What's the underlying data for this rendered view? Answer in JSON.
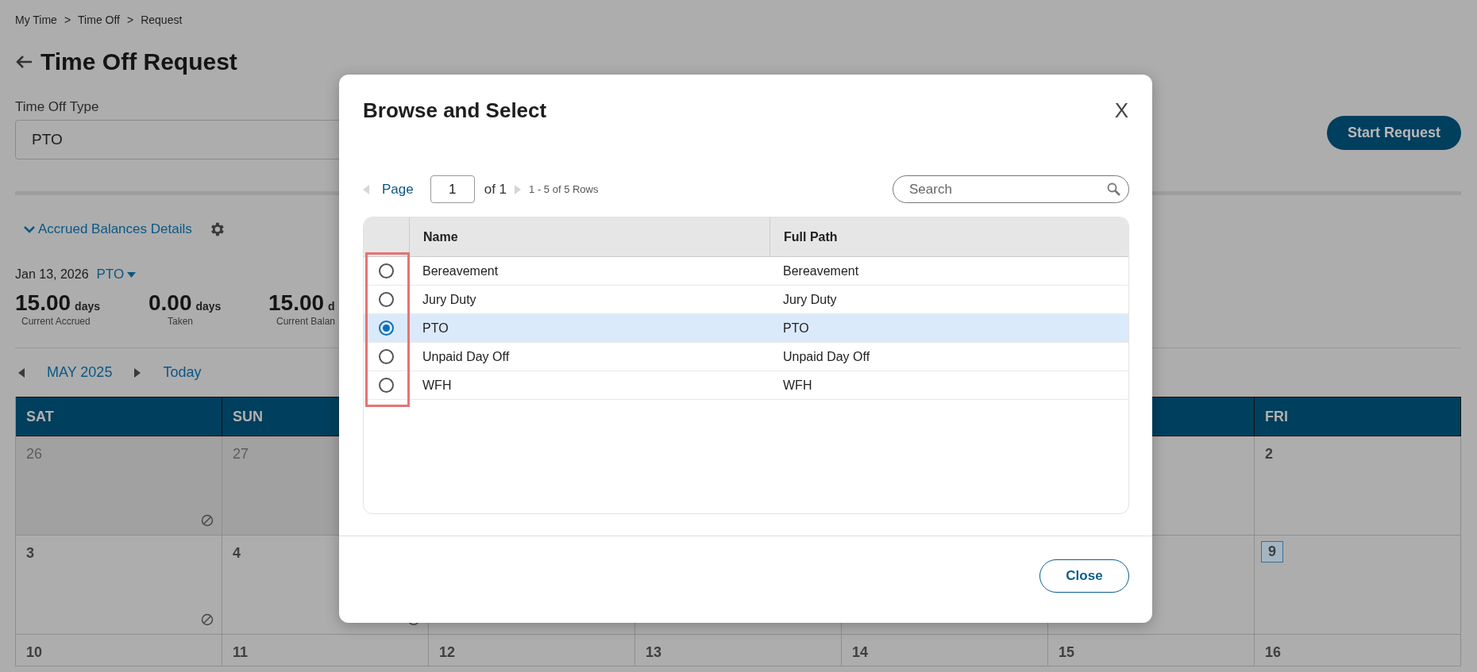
{
  "breadcrumb": {
    "separator": ">",
    "items": [
      "My Time",
      "Time Off",
      "Request"
    ]
  },
  "page_title": "Time Off Request",
  "time_off_type": {
    "label": "Time Off Type",
    "value": "PTO"
  },
  "start_request_button": "Start Request",
  "accrued_toggle": {
    "label": "Accrued Balances Details",
    "expanded": true
  },
  "balance_date": "Jan 13, 2026",
  "balance_type": "PTO",
  "balances": [
    {
      "value": "15.00",
      "unit": "days",
      "label": "Current Accrued"
    },
    {
      "value": "0.00",
      "unit": "days",
      "label": "Taken"
    },
    {
      "value": "15.00",
      "unit": "d",
      "label": "Current Balan"
    }
  ],
  "month_nav": {
    "month": "MAY 2025",
    "today": "Today"
  },
  "calendar": {
    "columns": [
      {
        "label": "SAT"
      },
      {
        "label": "SUN"
      },
      {},
      {},
      {},
      {},
      {
        "label": "FRI"
      }
    ],
    "rows": [
      [
        {
          "day": "26",
          "muted": true,
          "blocked": true
        },
        {
          "day": "27",
          "muted": true,
          "blocked": false
        },
        {},
        {},
        {},
        {},
        {
          "day": "2",
          "muted": false,
          "blocked": false,
          "today": false
        }
      ],
      [
        {
          "day": "3",
          "muted": false,
          "blocked": true
        },
        {
          "day": "4",
          "muted": false,
          "blocked": true
        },
        {},
        {},
        {},
        {},
        {
          "day": "9",
          "muted": false,
          "blocked": false,
          "today": true
        }
      ],
      [
        {
          "day": "10"
        },
        {
          "day": "11"
        },
        {
          "day": "12"
        },
        {
          "day": "13"
        },
        {
          "day": "14"
        },
        {
          "day": "15"
        },
        {
          "day": "16"
        }
      ]
    ]
  },
  "dialog": {
    "title": "Browse and Select",
    "close_icon": "X",
    "pager": {
      "label": "Page",
      "page": "1",
      "of": "of 1",
      "rows_info": "1 - 5 of 5 Rows"
    },
    "search": {
      "placeholder": "Search"
    },
    "table": {
      "columns": [
        "Name",
        "Full Path"
      ],
      "rows": [
        {
          "name": "Bereavement",
          "full_path": "Bereavement",
          "selected": false
        },
        {
          "name": "Jury Duty",
          "full_path": "Jury Duty",
          "selected": false
        },
        {
          "name": "PTO",
          "full_path": "PTO",
          "selected": true
        },
        {
          "name": "Unpaid Day Off",
          "full_path": "Unpaid Day Off",
          "selected": false
        },
        {
          "name": "WFH",
          "full_path": "WFH",
          "selected": false
        }
      ]
    },
    "close_button": "Close"
  }
}
